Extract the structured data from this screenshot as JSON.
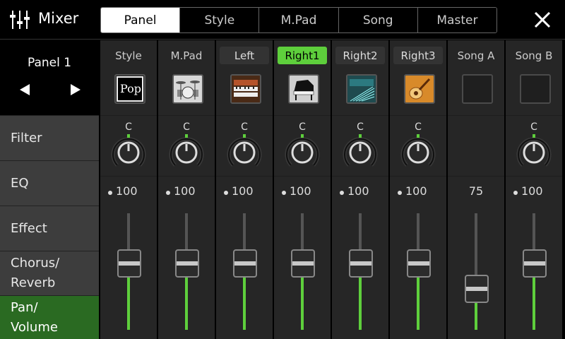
{
  "header": {
    "title": "Mixer",
    "tabs": [
      {
        "label": "Panel",
        "active": true
      },
      {
        "label": "Style",
        "active": false
      },
      {
        "label": "M.Pad",
        "active": false
      },
      {
        "label": "Song",
        "active": false
      },
      {
        "label": "Master",
        "active": false
      }
    ],
    "close_icon": "close-icon"
  },
  "panel_selector": {
    "name": "Panel 1",
    "prev_icon": "triangle-left-icon",
    "next_icon": "triangle-right-icon"
  },
  "side_menu": [
    {
      "label": "Filter",
      "active": false
    },
    {
      "label": "EQ",
      "active": false
    },
    {
      "label": "Effect",
      "active": false
    },
    {
      "label": "Chorus/\nReverb",
      "active": false
    },
    {
      "label": "Pan/\nVolume",
      "active": true
    }
  ],
  "channels": [
    {
      "label": "Style",
      "label_style": "plain",
      "icon": "pop-style-icon",
      "pan": "C",
      "volume": "100",
      "volume_level": 100
    },
    {
      "label": "M.Pad",
      "label_style": "plain",
      "icon": "drum-kit-icon",
      "pan": "C",
      "volume": "100",
      "volume_level": 100
    },
    {
      "label": "Left",
      "label_style": "boxed",
      "icon": "organ-icon",
      "pan": "C",
      "volume": "100",
      "volume_level": 100
    },
    {
      "label": "Right1",
      "label_style": "active",
      "icon": "grand-piano-icon",
      "pan": "C",
      "volume": "100",
      "volume_level": 100
    },
    {
      "label": "Right2",
      "label_style": "boxed",
      "icon": "synth-keyboard-icon",
      "pan": "C",
      "volume": "100",
      "volume_level": 100
    },
    {
      "label": "Right3",
      "label_style": "boxed",
      "icon": "acoustic-guitar-icon",
      "pan": "C",
      "volume": "100",
      "volume_level": 100
    },
    {
      "label": "Song A",
      "label_style": "plain",
      "icon": "empty-slot-icon",
      "pan": "",
      "volume": "75",
      "volume_level": 75
    },
    {
      "label": "Song B",
      "label_style": "plain",
      "icon": "empty-slot-icon",
      "pan": "C",
      "volume": "100",
      "volume_level": 100
    }
  ],
  "style_icon_text": "Pop",
  "colors": {
    "accent_green": "#5ecf3c",
    "active_menu": "#2a6a22"
  }
}
